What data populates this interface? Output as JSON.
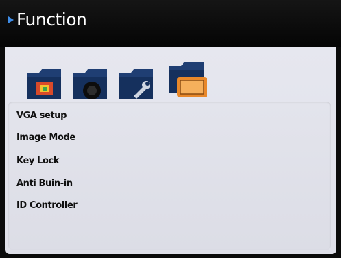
{
  "header": {
    "title": "Function"
  },
  "icons": [
    {
      "name": "color-folder-icon"
    },
    {
      "name": "image-folder-icon"
    },
    {
      "name": "tools-folder-icon"
    },
    {
      "name": "monitor-folder-icon",
      "selected": true
    }
  ],
  "menu": {
    "items": [
      {
        "label": "VGA setup"
      },
      {
        "label": "Image Mode"
      },
      {
        "label": "Key Lock"
      },
      {
        "label": "Anti Buin-in"
      },
      {
        "label": "ID Controller"
      }
    ]
  },
  "colors": {
    "accent": "#3f8de8",
    "folder": "#1f3e73",
    "selected": "#e8882a"
  }
}
